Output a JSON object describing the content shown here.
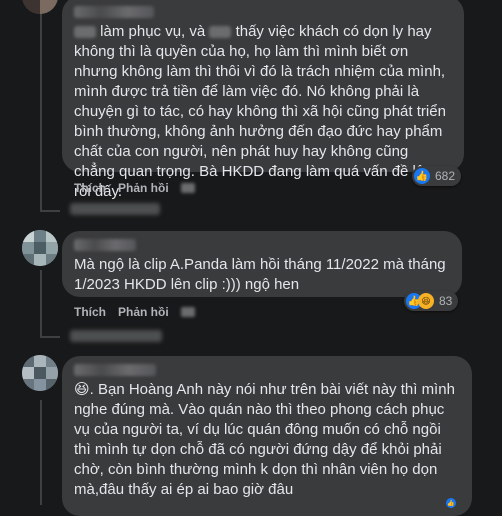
{
  "comments": [
    {
      "text_segments": {
        "a": "làm phục vụ, và",
        "b": "thấy việc khách có dọn ly hay không thì là quyền của họ, họ làm thì mình biết ơn nhưng không làm thì thôi vì đó là trách nhiệm của mình, mình được trả tiền để làm việc đó. Nó không phải là chuyện gì to tác, có hay không thì xã hội cũng phát triển bình thường, không ảnh hưởng đến đạo đức hay phẩm chất của con người, nên phát huy hay không cũng chẳng quan trọng. Bà HKDD đang làm quá vấn đề lên rồi đấy."
      },
      "like_label": "Thích",
      "reply_label": "Phản hồi",
      "reaction_count": "682",
      "reactions": [
        "like-icon"
      ]
    },
    {
      "text": "Mà ngộ là clip A.Panda làm hồi tháng 11/2022 mà tháng 1/2023 HKDD lên clip :))) ngộ hen",
      "like_label": "Thích",
      "reply_label": "Phản hồi",
      "reaction_count": "83",
      "reactions": [
        "like-icon",
        "haha-icon"
      ]
    },
    {
      "text": "😆. Bạn Hoàng Anh này nói như trên bài viết này thì mình nghe đúng mà. Vào quán nào thì theo phong cách phục vụ của người ta, ví dụ lúc quán đông muốn có chỗ ngồi thì mình tự dọn chỗ đã có người đứng dậy để khỏi phải chờ, còn bình thường mình k dọn thì nhân viên họ dọn mà,đâu thấy ai ép ai bao giờ đâu"
    }
  ],
  "colors": {
    "background": "#18191a",
    "bubble": "#3a3b3c",
    "text": "#e4e6eb",
    "secondary": "#b0b3b8",
    "like": "#1877f2",
    "haha": "#f7b125"
  }
}
